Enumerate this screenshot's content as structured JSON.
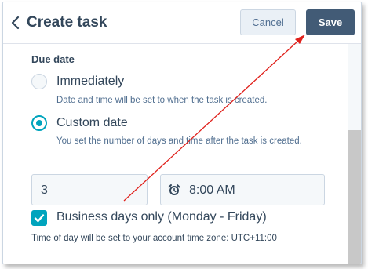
{
  "header": {
    "title": "Create task",
    "back_icon": "chevron-left-icon",
    "cancel_label": "Cancel",
    "save_label": "Save"
  },
  "due_date": {
    "label": "Due date",
    "options": [
      {
        "label": "Immediately",
        "hint": "Date and time will be set to when the task is created.",
        "selected": false
      },
      {
        "label": "Custom date",
        "hint": "You set the number of days and time after the task is created.",
        "selected": true
      }
    ],
    "days_value": "3",
    "time_value": "8:00 AM",
    "time_icon": "alarm-clock-icon",
    "business_days_label": "Business days only (Monday - Friday)",
    "business_days_checked": true,
    "timezone_note": "Time of day will be set to your account time zone: UTC+11:00"
  },
  "colors": {
    "accent": "#00a4bd",
    "save_button": "#425b76",
    "annotation_arrow": "#e0201b"
  }
}
